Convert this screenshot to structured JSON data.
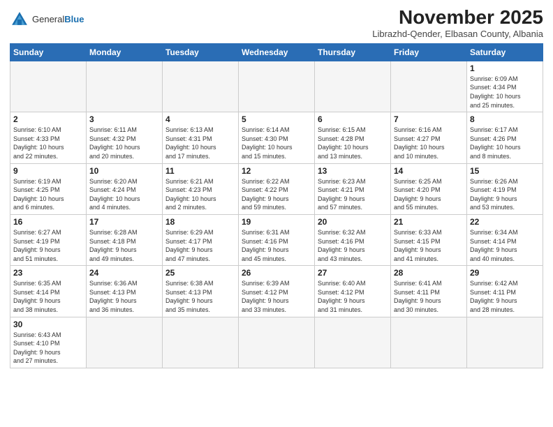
{
  "header": {
    "logo_general": "General",
    "logo_blue": "Blue",
    "month_title": "November 2025",
    "location": "Librazhd-Qender, Elbasan County, Albania"
  },
  "weekdays": [
    "Sunday",
    "Monday",
    "Tuesday",
    "Wednesday",
    "Thursday",
    "Friday",
    "Saturday"
  ],
  "weeks": [
    [
      {
        "day": "",
        "info": ""
      },
      {
        "day": "",
        "info": ""
      },
      {
        "day": "",
        "info": ""
      },
      {
        "day": "",
        "info": ""
      },
      {
        "day": "",
        "info": ""
      },
      {
        "day": "",
        "info": ""
      },
      {
        "day": "1",
        "info": "Sunrise: 6:09 AM\nSunset: 4:34 PM\nDaylight: 10 hours\nand 25 minutes."
      }
    ],
    [
      {
        "day": "2",
        "info": "Sunrise: 6:10 AM\nSunset: 4:33 PM\nDaylight: 10 hours\nand 22 minutes."
      },
      {
        "day": "3",
        "info": "Sunrise: 6:11 AM\nSunset: 4:32 PM\nDaylight: 10 hours\nand 20 minutes."
      },
      {
        "day": "4",
        "info": "Sunrise: 6:13 AM\nSunset: 4:31 PM\nDaylight: 10 hours\nand 17 minutes."
      },
      {
        "day": "5",
        "info": "Sunrise: 6:14 AM\nSunset: 4:30 PM\nDaylight: 10 hours\nand 15 minutes."
      },
      {
        "day": "6",
        "info": "Sunrise: 6:15 AM\nSunset: 4:28 PM\nDaylight: 10 hours\nand 13 minutes."
      },
      {
        "day": "7",
        "info": "Sunrise: 6:16 AM\nSunset: 4:27 PM\nDaylight: 10 hours\nand 10 minutes."
      },
      {
        "day": "8",
        "info": "Sunrise: 6:17 AM\nSunset: 4:26 PM\nDaylight: 10 hours\nand 8 minutes."
      }
    ],
    [
      {
        "day": "9",
        "info": "Sunrise: 6:19 AM\nSunset: 4:25 PM\nDaylight: 10 hours\nand 6 minutes."
      },
      {
        "day": "10",
        "info": "Sunrise: 6:20 AM\nSunset: 4:24 PM\nDaylight: 10 hours\nand 4 minutes."
      },
      {
        "day": "11",
        "info": "Sunrise: 6:21 AM\nSunset: 4:23 PM\nDaylight: 10 hours\nand 2 minutes."
      },
      {
        "day": "12",
        "info": "Sunrise: 6:22 AM\nSunset: 4:22 PM\nDaylight: 9 hours\nand 59 minutes."
      },
      {
        "day": "13",
        "info": "Sunrise: 6:23 AM\nSunset: 4:21 PM\nDaylight: 9 hours\nand 57 minutes."
      },
      {
        "day": "14",
        "info": "Sunrise: 6:25 AM\nSunset: 4:20 PM\nDaylight: 9 hours\nand 55 minutes."
      },
      {
        "day": "15",
        "info": "Sunrise: 6:26 AM\nSunset: 4:19 PM\nDaylight: 9 hours\nand 53 minutes."
      }
    ],
    [
      {
        "day": "16",
        "info": "Sunrise: 6:27 AM\nSunset: 4:19 PM\nDaylight: 9 hours\nand 51 minutes."
      },
      {
        "day": "17",
        "info": "Sunrise: 6:28 AM\nSunset: 4:18 PM\nDaylight: 9 hours\nand 49 minutes."
      },
      {
        "day": "18",
        "info": "Sunrise: 6:29 AM\nSunset: 4:17 PM\nDaylight: 9 hours\nand 47 minutes."
      },
      {
        "day": "19",
        "info": "Sunrise: 6:31 AM\nSunset: 4:16 PM\nDaylight: 9 hours\nand 45 minutes."
      },
      {
        "day": "20",
        "info": "Sunrise: 6:32 AM\nSunset: 4:16 PM\nDaylight: 9 hours\nand 43 minutes."
      },
      {
        "day": "21",
        "info": "Sunrise: 6:33 AM\nSunset: 4:15 PM\nDaylight: 9 hours\nand 41 minutes."
      },
      {
        "day": "22",
        "info": "Sunrise: 6:34 AM\nSunset: 4:14 PM\nDaylight: 9 hours\nand 40 minutes."
      }
    ],
    [
      {
        "day": "23",
        "info": "Sunrise: 6:35 AM\nSunset: 4:14 PM\nDaylight: 9 hours\nand 38 minutes."
      },
      {
        "day": "24",
        "info": "Sunrise: 6:36 AM\nSunset: 4:13 PM\nDaylight: 9 hours\nand 36 minutes."
      },
      {
        "day": "25",
        "info": "Sunrise: 6:38 AM\nSunset: 4:13 PM\nDaylight: 9 hours\nand 35 minutes."
      },
      {
        "day": "26",
        "info": "Sunrise: 6:39 AM\nSunset: 4:12 PM\nDaylight: 9 hours\nand 33 minutes."
      },
      {
        "day": "27",
        "info": "Sunrise: 6:40 AM\nSunset: 4:12 PM\nDaylight: 9 hours\nand 31 minutes."
      },
      {
        "day": "28",
        "info": "Sunrise: 6:41 AM\nSunset: 4:11 PM\nDaylight: 9 hours\nand 30 minutes."
      },
      {
        "day": "29",
        "info": "Sunrise: 6:42 AM\nSunset: 4:11 PM\nDaylight: 9 hours\nand 28 minutes."
      }
    ],
    [
      {
        "day": "30",
        "info": "Sunrise: 6:43 AM\nSunset: 4:10 PM\nDaylight: 9 hours\nand 27 minutes."
      },
      {
        "day": "",
        "info": ""
      },
      {
        "day": "",
        "info": ""
      },
      {
        "day": "",
        "info": ""
      },
      {
        "day": "",
        "info": ""
      },
      {
        "day": "",
        "info": ""
      },
      {
        "day": "",
        "info": ""
      }
    ]
  ]
}
